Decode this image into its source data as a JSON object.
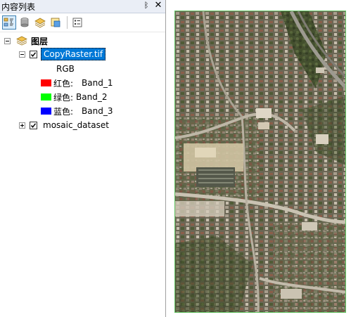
{
  "panel": {
    "title": "内容列表",
    "pin_glyph": "ᛒ",
    "close_glyph": "✕"
  },
  "toolbar": {
    "buttons": [
      {
        "icon": "list-by-drawing-order-icon"
      },
      {
        "icon": "list-by-source-icon"
      },
      {
        "icon": "list-by-visibility-icon"
      },
      {
        "icon": "list-by-selection-icon"
      },
      {
        "icon": "options-icon"
      }
    ]
  },
  "toc": {
    "root_label": "图层",
    "layers": [
      {
        "name": "CopyRaster.tif",
        "checked": true,
        "expanded": true,
        "selected": true,
        "legend_heading": "RGB",
        "bands": [
          {
            "label": "红色:",
            "band": "Band_1",
            "color": "#ff0000"
          },
          {
            "label": "绿色:",
            "band": "Band_2",
            "color": "#00ff00"
          },
          {
            "label": "蓝色:",
            "band": "Band_3",
            "color": "#0000ff"
          }
        ]
      },
      {
        "name": "mosaic_dataset",
        "checked": true,
        "expanded": false,
        "selected": false
      }
    ]
  },
  "colors": {
    "accent": "#0078d7",
    "map_border": "#62c462"
  }
}
